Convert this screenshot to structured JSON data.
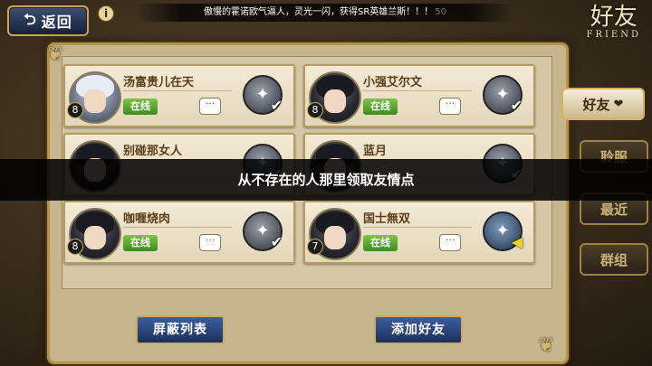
{
  "header": {
    "back_label": "返回",
    "back_arrow": "⮌",
    "info_glyph": "i",
    "ticker": "傲慢的霍诺欧气逼人，灵光一闪，获得SR英雄兰斯！！！",
    "ticker_tail": "50",
    "title": "好友",
    "title_en": "FRIEND"
  },
  "friends": [
    {
      "name": "汤富贵儿在天",
      "level": "8",
      "status": "在线",
      "avatar": "light-hair-avatar",
      "gift": "sent"
    },
    {
      "name": "小强艾尔文",
      "level": "8",
      "status": "在线",
      "avatar": "dark-hair-avatar",
      "gift": "sent"
    },
    {
      "name": "别碰那女人",
      "level": "",
      "status": "",
      "avatar": "dark-hair-avatar",
      "gift": "sent"
    },
    {
      "name": "蓝月",
      "level": "",
      "status": "",
      "avatar": "dark-hair-avatar",
      "gift": "sent"
    },
    {
      "name": "咖喱烧肉",
      "level": "8",
      "status": "在线",
      "avatar": "dark-hair-avatar",
      "gift": "sent"
    },
    {
      "name": "国士無双",
      "level": "7",
      "status": "在线",
      "avatar": "dark-hair-avatar",
      "gift": "receive"
    }
  ],
  "chat_glyph": "···",
  "check_glyph": "✔",
  "arrow_glyph": "◀",
  "side_tabs": [
    {
      "label": "好友",
      "icon": "heart-icon",
      "glyph": "❤",
      "active": true
    },
    {
      "label": "聆服",
      "active": false
    },
    {
      "label": "最近",
      "active": false
    },
    {
      "label": "群组",
      "active": false
    }
  ],
  "buttons": {
    "block_list": "屏蔽列表",
    "add_friend": "添加好友"
  },
  "toast": "从不存在的人那里领取友情点",
  "colors": {
    "online_green": "#5aa832",
    "button_blue": "#2a4a86",
    "gold_border": "#c9a85a"
  }
}
